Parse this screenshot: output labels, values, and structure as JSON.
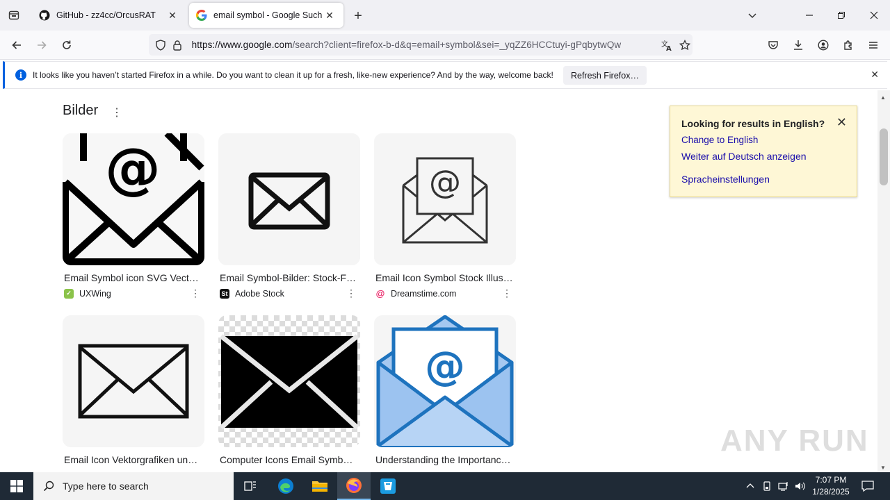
{
  "browser": {
    "tabs": [
      {
        "title": "GitHub - zz4cc/OrcusRAT",
        "icon": "github-icon"
      },
      {
        "title": "email symbol - Google Suche",
        "icon": "google-g-icon"
      }
    ],
    "url_host": "https://www.google.com",
    "url_path": "/search?client=firefox-b-d&q=email+symbol&sei=_yqZZ6HCCtuyi-gPqbytwQw"
  },
  "notification": {
    "message": "It looks like you haven’t started Firefox in a while. Do you want to clean it up for a fresh, like-new experience? And by the way, welcome back!",
    "action": "Refresh Firefox…"
  },
  "results": {
    "section_title": "Bilder",
    "images": [
      {
        "caption": "Email Symbol icon SVG Vecto…",
        "source": "UXWing",
        "source_color": "#2e7d32"
      },
      {
        "caption": "Email Symbol-Bilder: Stock-F…",
        "source": "Adobe Stock",
        "source_color": "#000000",
        "source_letter": "St"
      },
      {
        "caption": "Email Icon Symbol Stock Illust…",
        "source": "Dreamstime.com",
        "source_color": "#e91e63"
      },
      {
        "caption": "Email Icon Vektorgrafiken un…",
        "source": "",
        "source_color": "#f57c00"
      },
      {
        "caption": "Computer Icons Email Symbo…",
        "source": "",
        "source_color": "#c2185b"
      },
      {
        "caption": "Understanding the Importanc…",
        "source": "",
        "source_color": "#333333"
      }
    ]
  },
  "language_box": {
    "title": "Looking for results in English?",
    "link1": "Change to English",
    "link2": "Weiter auf Deutsch anzeigen",
    "link3": "Spracheinstellungen"
  },
  "taskbar": {
    "search_placeholder": "Type here to search",
    "time": "7:07 PM",
    "date": "1/28/2025"
  },
  "watermark": "ANY RUN"
}
